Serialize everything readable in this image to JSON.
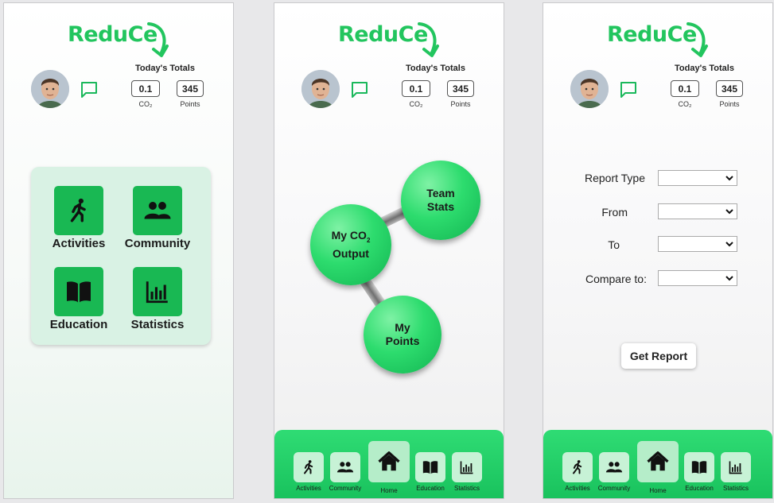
{
  "brand": {
    "logo_text": "ReduCe",
    "accent_color": "#22c55e"
  },
  "header": {
    "totals_title": "Today's Totals",
    "co2_value": "0.1",
    "co2_label": "CO₂",
    "points_value": "345",
    "points_label": "Points"
  },
  "screen1": {
    "menu": [
      {
        "label": "Activities",
        "icon": "walking-person-icon"
      },
      {
        "label": "Community",
        "icon": "people-icon"
      },
      {
        "label": "Education",
        "icon": "book-icon"
      },
      {
        "label": "Statistics",
        "icon": "bar-chart-icon"
      }
    ]
  },
  "screen2": {
    "bubbles": {
      "team_stats": "Team\nStats",
      "my_co2_prefix": "My CO",
      "my_co2_sub": "2",
      "my_co2_suffix": "Output",
      "my_points": "My\nPoints"
    }
  },
  "screen3": {
    "fields": [
      {
        "label": "Report Type",
        "value": ""
      },
      {
        "label": "From",
        "value": ""
      },
      {
        "label": "To",
        "value": ""
      },
      {
        "label": "Compare to:",
        "value": ""
      }
    ],
    "get_report_label": "Get Report"
  },
  "bottom_nav": {
    "items": [
      {
        "label": "Activities",
        "icon": "walking-person-icon"
      },
      {
        "label": "Community",
        "icon": "people-icon"
      },
      {
        "label": "Home",
        "icon": "home-icon"
      },
      {
        "label": "Education",
        "icon": "book-icon"
      },
      {
        "label": "Statistics",
        "icon": "bar-chart-icon"
      }
    ]
  }
}
